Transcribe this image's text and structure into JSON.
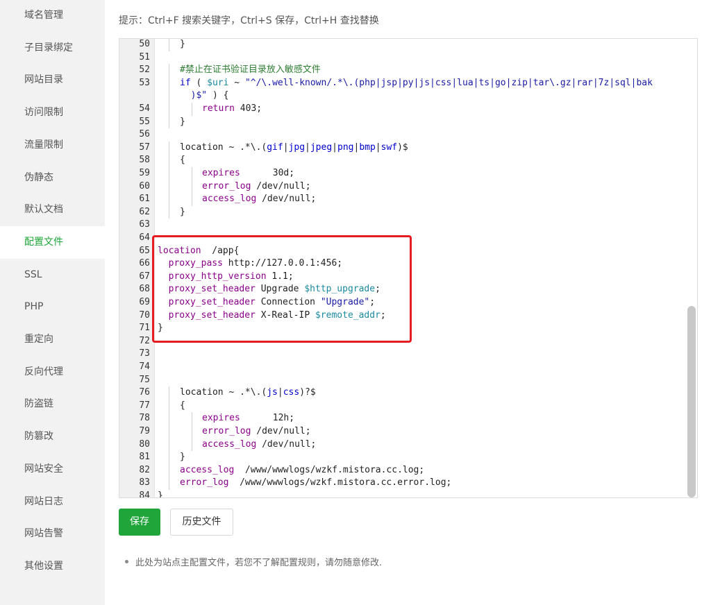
{
  "sidebar": {
    "active_index": 7,
    "items": [
      {
        "label": "域名管理"
      },
      {
        "label": "子目录绑定"
      },
      {
        "label": "网站目录"
      },
      {
        "label": "访问限制"
      },
      {
        "label": "流量限制"
      },
      {
        "label": "伪静态"
      },
      {
        "label": "默认文档"
      },
      {
        "label": "配置文件"
      },
      {
        "label": "SSL"
      },
      {
        "label": "PHP"
      },
      {
        "label": "重定向"
      },
      {
        "label": "反向代理"
      },
      {
        "label": "防盗链"
      },
      {
        "label": "防篡改"
      },
      {
        "label": "网站安全"
      },
      {
        "label": "网站日志"
      },
      {
        "label": "网站告警"
      },
      {
        "label": "其他设置"
      }
    ]
  },
  "hint": "提示：Ctrl+F 搜索关键字，Ctrl+S 保存，Ctrl+H 查找替换",
  "editor": {
    "lines": [
      {
        "n": "50",
        "indent": 1,
        "segs": [
          [
            "plain",
            "}"
          ]
        ]
      },
      {
        "n": "51",
        "indent": 0,
        "segs": []
      },
      {
        "n": "52",
        "indent": 1,
        "segs": [
          [
            "cm",
            "#禁止在证书验证目录放入敏感文件"
          ]
        ]
      },
      {
        "n": "53",
        "indent": 1,
        "segs": [
          [
            "kw",
            "if"
          ],
          [
            "plain",
            " ( "
          ],
          [
            "var",
            "$uri"
          ],
          [
            "plain",
            " ~ "
          ],
          [
            "str",
            "\"^/\\.well-known/.*\\.(php|jsp|py|js|css|lua|ts|go|zip|tar\\.gz|rar|7z|sql|bak"
          ]
        ]
      },
      {
        "n": "",
        "indent": 1,
        "cont": true,
        "segs": [
          [
            "str",
            "  )$\""
          ],
          [
            "plain",
            " ) {"
          ]
        ]
      },
      {
        "n": "54",
        "indent": 2,
        "segs": [
          [
            "dir",
            "return"
          ],
          [
            "plain",
            " 403;"
          ]
        ]
      },
      {
        "n": "55",
        "indent": 1,
        "segs": [
          [
            "plain",
            "}"
          ]
        ]
      },
      {
        "n": "56",
        "indent": 0,
        "segs": []
      },
      {
        "n": "57",
        "indent": 1,
        "segs": [
          [
            "plain",
            "location ~ .*\\.("
          ],
          [
            "kw",
            "gif"
          ],
          [
            "plain",
            "|"
          ],
          [
            "kw",
            "jpg"
          ],
          [
            "plain",
            "|"
          ],
          [
            "kw",
            "jpeg"
          ],
          [
            "plain",
            "|"
          ],
          [
            "kw",
            "png"
          ],
          [
            "plain",
            "|"
          ],
          [
            "kw",
            "bmp"
          ],
          [
            "plain",
            "|"
          ],
          [
            "kw",
            "swf"
          ],
          [
            "plain",
            ")$"
          ]
        ]
      },
      {
        "n": "58",
        "indent": 1,
        "segs": [
          [
            "plain",
            "{"
          ]
        ]
      },
      {
        "n": "59",
        "indent": 2,
        "segs": [
          [
            "dir",
            "expires"
          ],
          [
            "plain",
            "      30d;"
          ]
        ]
      },
      {
        "n": "60",
        "indent": 2,
        "segs": [
          [
            "dir",
            "error_log"
          ],
          [
            "plain",
            " /dev/null;"
          ]
        ]
      },
      {
        "n": "61",
        "indent": 2,
        "segs": [
          [
            "dir",
            "access_log"
          ],
          [
            "plain",
            " /dev/null;"
          ]
        ]
      },
      {
        "n": "62",
        "indent": 1,
        "segs": [
          [
            "plain",
            "}"
          ]
        ]
      },
      {
        "n": "63",
        "indent": 0,
        "segs": []
      },
      {
        "n": "64",
        "indent": 0,
        "segs": []
      },
      {
        "n": "65",
        "indent": 0,
        "segs": [
          [
            "dir",
            "location"
          ],
          [
            "plain",
            "  /app{"
          ]
        ]
      },
      {
        "n": "66",
        "indent": 0,
        "segs": [
          [
            "dir",
            "  proxy_pass"
          ],
          [
            "plain",
            " http://127.0.0.1:456;"
          ]
        ]
      },
      {
        "n": "67",
        "indent": 0,
        "segs": [
          [
            "dir",
            "  proxy_http_version"
          ],
          [
            "plain",
            " 1.1;"
          ]
        ]
      },
      {
        "n": "68",
        "indent": 0,
        "segs": [
          [
            "dir",
            "  proxy_set_header"
          ],
          [
            "plain",
            " Upgrade "
          ],
          [
            "var",
            "$http_upgrade"
          ],
          [
            "plain",
            ";"
          ]
        ]
      },
      {
        "n": "69",
        "indent": 0,
        "segs": [
          [
            "dir",
            "  proxy_set_header"
          ],
          [
            "plain",
            " Connection "
          ],
          [
            "str",
            "\"Upgrade\""
          ],
          [
            "plain",
            ";"
          ]
        ]
      },
      {
        "n": "70",
        "indent": 0,
        "segs": [
          [
            "dir",
            "  proxy_set_header"
          ],
          [
            "plain",
            " X-Real-IP "
          ],
          [
            "var",
            "$remote_addr"
          ],
          [
            "plain",
            ";"
          ]
        ]
      },
      {
        "n": "71",
        "indent": 0,
        "segs": [
          [
            "plain",
            "}"
          ]
        ]
      },
      {
        "n": "72",
        "indent": 0,
        "segs": []
      },
      {
        "n": "73",
        "indent": 0,
        "segs": []
      },
      {
        "n": "74",
        "indent": 0,
        "segs": []
      },
      {
        "n": "75",
        "indent": 0,
        "segs": []
      },
      {
        "n": "76",
        "indent": 1,
        "segs": [
          [
            "plain",
            "location ~ .*\\.("
          ],
          [
            "kw",
            "js"
          ],
          [
            "plain",
            "|"
          ],
          [
            "kw",
            "css"
          ],
          [
            "plain",
            ")?$"
          ]
        ]
      },
      {
        "n": "77",
        "indent": 1,
        "segs": [
          [
            "plain",
            "{"
          ]
        ]
      },
      {
        "n": "78",
        "indent": 2,
        "segs": [
          [
            "dir",
            "expires"
          ],
          [
            "plain",
            "      12h;"
          ]
        ]
      },
      {
        "n": "79",
        "indent": 2,
        "segs": [
          [
            "dir",
            "error_log"
          ],
          [
            "plain",
            " /dev/null;"
          ]
        ]
      },
      {
        "n": "80",
        "indent": 2,
        "segs": [
          [
            "dir",
            "access_log"
          ],
          [
            "plain",
            " /dev/null;"
          ]
        ]
      },
      {
        "n": "81",
        "indent": 1,
        "segs": [
          [
            "plain",
            "}"
          ]
        ]
      },
      {
        "n": "82",
        "indent": 1,
        "segs": [
          [
            "dir",
            "access_log"
          ],
          [
            "plain",
            "  /www/wwwlogs/wzkf.mistora.cc.log;"
          ]
        ]
      },
      {
        "n": "83",
        "indent": 1,
        "segs": [
          [
            "dir",
            "error_log"
          ],
          [
            "plain",
            "  /www/wwwlogs/wzkf.mistora.cc.error.log;"
          ]
        ]
      },
      {
        "n": "84",
        "indent": 0,
        "segs": [
          [
            "plain",
            "}"
          ]
        ]
      }
    ]
  },
  "buttons": {
    "save": "保存",
    "history": "历史文件"
  },
  "note": "此处为站点主配置文件，若您不了解配置规则，请勿随意修改.",
  "colors": {
    "accent": "#20a53a",
    "highlight_border": "#e51c23"
  }
}
